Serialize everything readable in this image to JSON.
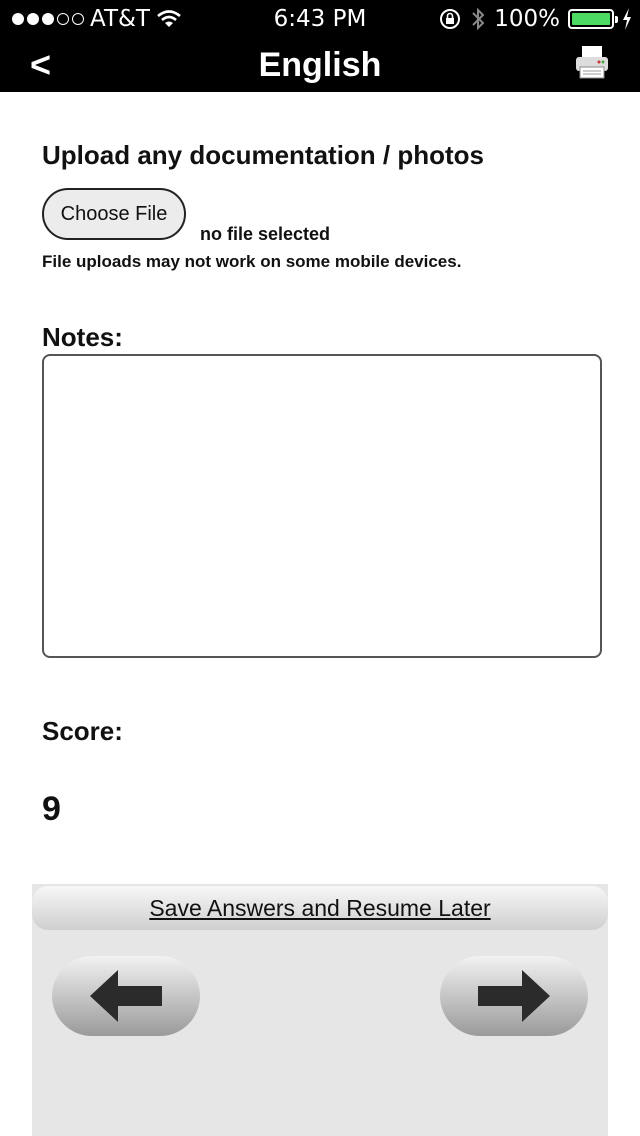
{
  "status_bar": {
    "carrier": "AT&T",
    "time": "6:43 PM",
    "battery": "100%",
    "signal_bars_filled": 3,
    "signal_bars_total": 5
  },
  "nav": {
    "back_label": "<",
    "title": "English",
    "print_icon": "printer-icon"
  },
  "upload": {
    "heading": "Upload any documentation / photos",
    "button_label": "Choose File",
    "file_status": "no file selected",
    "note": "File uploads may not work on some mobile devices."
  },
  "notes": {
    "label": "Notes:",
    "value": ""
  },
  "score": {
    "label": "Score:",
    "value": "9"
  },
  "footer": {
    "save_label": "Save Answers and Resume Later",
    "prev_icon": "arrow-left-icon",
    "next_icon": "arrow-right-icon"
  },
  "colors": {
    "bar_bg": "#000000",
    "battery_fill": "#4cd964",
    "footer_bg": "#e6e6e6"
  }
}
